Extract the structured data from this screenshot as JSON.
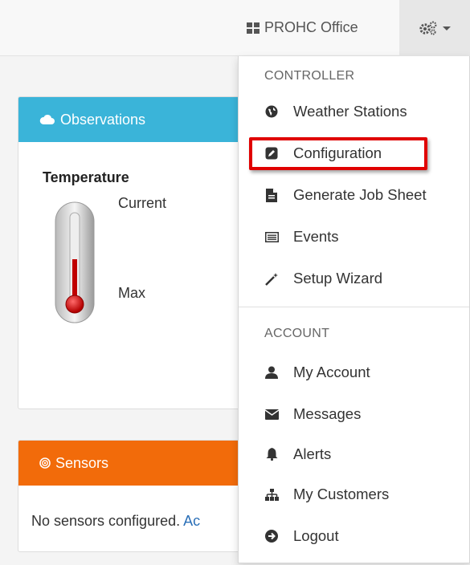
{
  "navbar": {
    "office_label": "PROHC Office",
    "office_icon": "grid-icon",
    "settings_icon": "gears-icon"
  },
  "observations": {
    "title": "Observations",
    "icon": "cloud-icon",
    "accent": "#3ab4d9",
    "temperature_title": "Temperature",
    "current_label": "Current",
    "max_label": "Max"
  },
  "sensors": {
    "title": "Sensors",
    "icon": "target-icon",
    "accent": "#f26b0a",
    "message": "No sensors configured. ",
    "link_fragment": "Ac"
  },
  "menu": {
    "controller_header": "CONTROLLER",
    "account_header": "ACCOUNT",
    "items": [
      {
        "label": "Weather Stations",
        "icon": "globe-icon"
      },
      {
        "label": "Configuration",
        "icon": "edit-icon"
      },
      {
        "label": "Generate Job Sheet",
        "icon": "file-icon"
      },
      {
        "label": "Events",
        "icon": "list-icon"
      },
      {
        "label": "Setup Wizard",
        "icon": "magic-wand-icon"
      },
      {
        "label": "My Account",
        "icon": "user-icon"
      },
      {
        "label": "Messages",
        "icon": "envelope-icon"
      },
      {
        "label": "Alerts",
        "icon": "bell-icon"
      },
      {
        "label": "My Customers",
        "icon": "sitemap-icon"
      },
      {
        "label": "Logout",
        "icon": "logout-icon"
      }
    ],
    "highlight_color": "#e00000"
  }
}
